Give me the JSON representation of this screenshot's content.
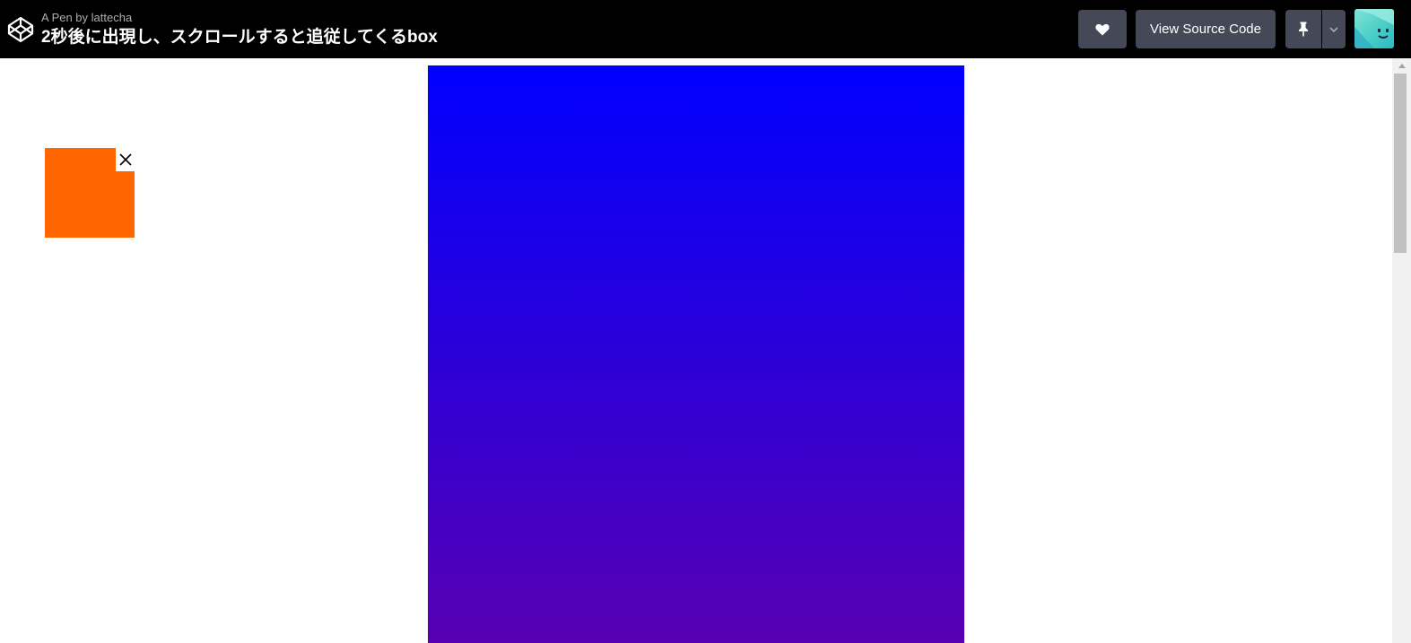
{
  "header": {
    "byline": "A Pen by lattecha",
    "title": "2秒後に出現し、スクロールすると追従してくるbox",
    "view_source_label": "View Source Code"
  },
  "icons": {
    "logo": "codepen-logo-icon",
    "heart": "heart-icon",
    "pin": "pin-icon",
    "caret": "chevron-down-icon",
    "close": "close-icon"
  },
  "colors": {
    "topbar_bg": "#000000",
    "button_bg": "#444857",
    "gradient_top": "#0000ff",
    "gradient_bottom": "#5a00b0",
    "follow_box": "#ff6600"
  }
}
